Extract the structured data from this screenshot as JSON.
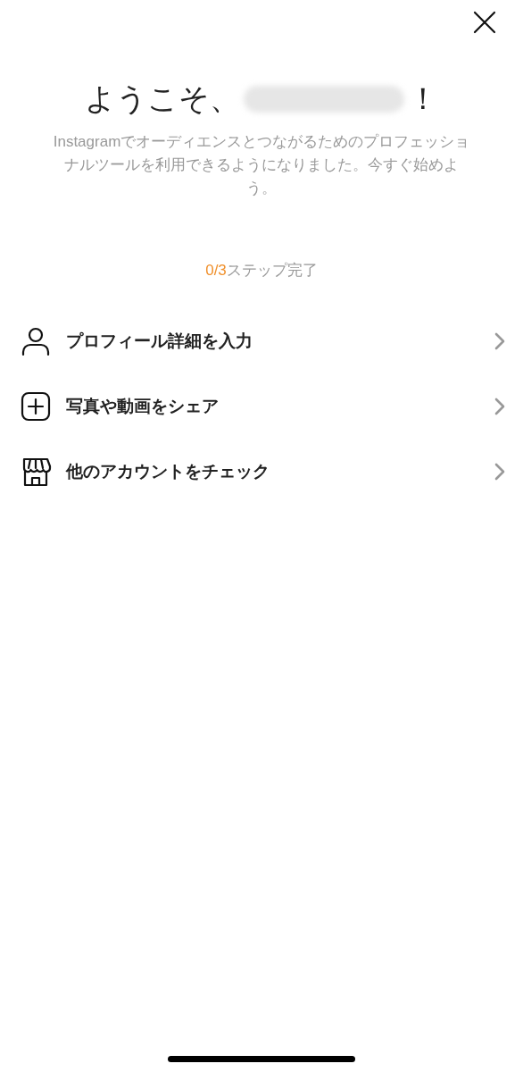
{
  "header": {
    "title_prefix": "ようこそ、",
    "title_suffix": "！",
    "name_redacted": true,
    "description": "Instagramでオーディエンスとつながるためのプロフェッショナルツールを利用できるようになりました。今すぐ始めよう。"
  },
  "progress": {
    "done": "0/3",
    "label": "ステップ完了"
  },
  "steps": [
    {
      "kind": "person",
      "label": "プロフィール詳細を入力"
    },
    {
      "kind": "plus",
      "label": "写真や動画をシェア"
    },
    {
      "kind": "store",
      "label": "他のアカウントをチェック"
    }
  ]
}
